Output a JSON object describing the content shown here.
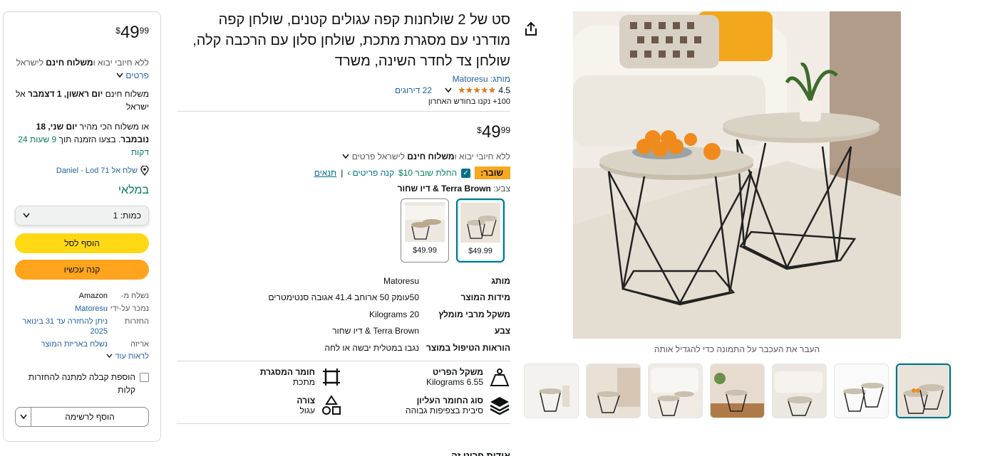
{
  "gallery": {
    "zoom_hint": "העבר את העכבר על התמונה כדי להגדיל אותה",
    "thumbnail_count": 7
  },
  "product": {
    "title": "סט של 2 שולחנות קפה עגולים קטנים, שולחן קפה מודרני עם מסגרת מתכת, שולחן סלון עם הרכבה קלה, שולחן צד לחדר השינה, משרד",
    "brand_prefix": "מותג:",
    "brand": "Matoresu",
    "rating": "4.5",
    "stars": "★★★★★",
    "reviews": "22 דירוגים",
    "bought": "100+ נקנו בחודש האחרון",
    "price_symbol": "$",
    "price_whole": "49",
    "price_fraction": "99",
    "import_text": "ללא חיובי יבוא ו",
    "free_shipping": "משלוח חינם",
    "import_tail": " לישראל פרטים",
    "coupon_label": "שובר:",
    "coupon_text": "החלת שובר $10",
    "coupon_link": "קנה פריטים ›",
    "coupon_terms": "תנאים",
    "color_label": "צבע:",
    "color_value": "Terra Brown & דיו שחור",
    "swatches": [
      {
        "price": "$49.99"
      },
      {
        "price": "$49.99"
      }
    ],
    "specs": [
      {
        "key": "מותג",
        "value": "Matoresu"
      },
      {
        "key": "מידות המוצר",
        "value": "50עומק 50 ארוחב 41.4 אגובה סנטימטרים"
      },
      {
        "key": "משקל מרבי מומלץ",
        "value": "20 Kilograms"
      },
      {
        "key": "צבע",
        "value": "Terra Brown & דיו שחור"
      },
      {
        "key": "הוראות הטיפול במוצר",
        "value": "נגבו במטלית יבשה או לחה"
      }
    ],
    "features": [
      {
        "key": "משקל הפריט",
        "value": "6.55 Kilograms"
      },
      {
        "key": "חומר המסגרת",
        "value": "מתכת"
      },
      {
        "key": "סוג החומר העליון",
        "value": "סיבית בצפיפות גבוהה"
      },
      {
        "key": "צורה",
        "value": "עגול"
      }
    ],
    "more_label": "אודות פריט זה"
  },
  "buybox": {
    "import_a": "ללא חיובי יבוא ו",
    "import_b": "משלוח חינם",
    "import_c": " לישראל",
    "details": "פרטים",
    "delivery_a": "משלוח חינם ",
    "delivery_b": "יום ראשון, 1 דצמבר",
    "delivery_c": " אל ישראל",
    "fast_a": "או משלוח הכי מהיר ",
    "fast_b": "יום שני, 18 נובמבר",
    "fast_c": ". בצעו הזמנה תוך ",
    "fast_d": "9 שעות 24 דקות",
    "deliver_to": "שלח אל Daniel - Lod 71",
    "stock": "במלאי",
    "qty_label": "כמות:",
    "qty_value": "1",
    "add_to_cart": "הוסף לסל",
    "buy_now": "קנה עכשיו",
    "seller": [
      {
        "key": "נשלח מ-",
        "value": "Amazon"
      },
      {
        "key": "נמכר על-ידי",
        "value": "Matoresu"
      },
      {
        "key": "החזרות",
        "value": "ניתן להחזרה עד 31 בינואר 2025"
      },
      {
        "key": "אריזה",
        "value": "נשלח באריזת המוצר"
      }
    ],
    "read_more": "לראות עוד",
    "gift_receipt": "הוספת קבלה למתנה להחזרות קלות",
    "add_to_list": "הוסף לרשימה"
  }
}
